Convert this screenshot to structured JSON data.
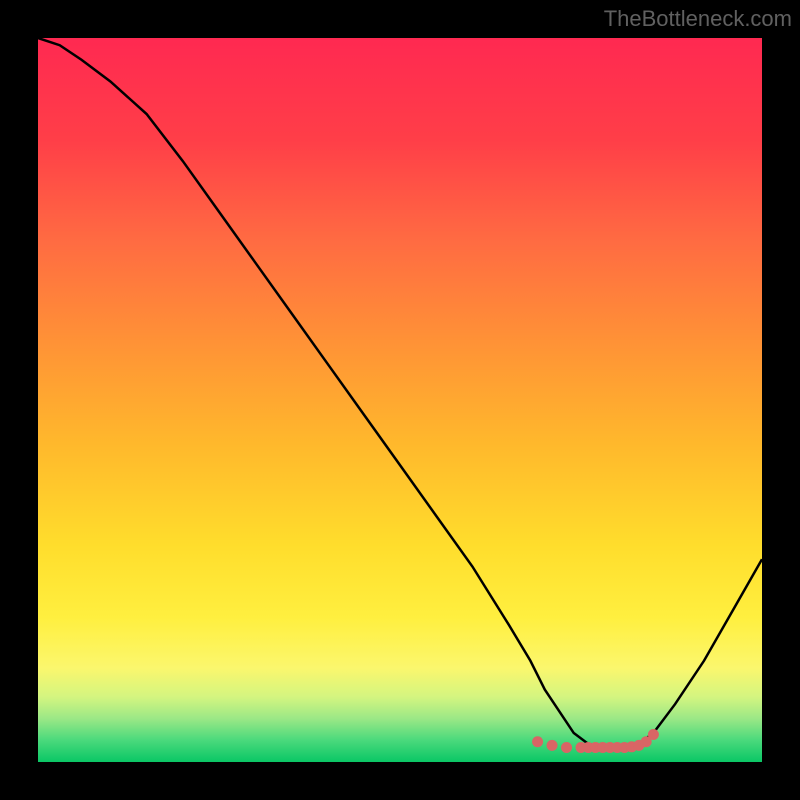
{
  "watermark": "TheBottleneck.com",
  "chart_data": {
    "type": "line",
    "title": "",
    "xlabel": "",
    "ylabel": "",
    "xlim": [
      0,
      100
    ],
    "ylim": [
      0,
      100
    ],
    "x": [
      0,
      3,
      6,
      10,
      15,
      20,
      25,
      30,
      35,
      40,
      45,
      50,
      55,
      60,
      65,
      68,
      70,
      72,
      74,
      76,
      78,
      80,
      82,
      83,
      85,
      88,
      92,
      96,
      100
    ],
    "values": [
      100,
      99,
      97,
      94,
      89.5,
      83,
      76,
      69,
      62,
      55,
      48,
      41,
      34,
      27,
      19,
      14,
      10,
      7,
      4,
      2.5,
      2,
      2,
      2,
      2.5,
      4,
      8,
      14,
      21,
      28
    ],
    "curve_color": "#000000",
    "marker_points": {
      "x": [
        69,
        71,
        73,
        75,
        76,
        77,
        78,
        79,
        80,
        81,
        82,
        83,
        84,
        85
      ],
      "y": [
        2.8,
        2.3,
        2,
        2,
        2,
        2,
        2,
        2,
        2,
        2,
        2.1,
        2.3,
        2.8,
        3.8
      ],
      "color": "#d96565"
    },
    "gradient_stops": [
      {
        "offset": 0,
        "color": "#ff2951"
      },
      {
        "offset": 14,
        "color": "#ff3e48"
      },
      {
        "offset": 28,
        "color": "#ff6b42"
      },
      {
        "offset": 42,
        "color": "#ff9236"
      },
      {
        "offset": 56,
        "color": "#ffb82c"
      },
      {
        "offset": 70,
        "color": "#ffdd2c"
      },
      {
        "offset": 80,
        "color": "#ffef3f"
      },
      {
        "offset": 87,
        "color": "#fbf76d"
      },
      {
        "offset": 91,
        "color": "#d4f580"
      },
      {
        "offset": 94,
        "color": "#9be886"
      },
      {
        "offset": 97,
        "color": "#4ad97c"
      },
      {
        "offset": 100,
        "color": "#0ac765"
      }
    ]
  }
}
